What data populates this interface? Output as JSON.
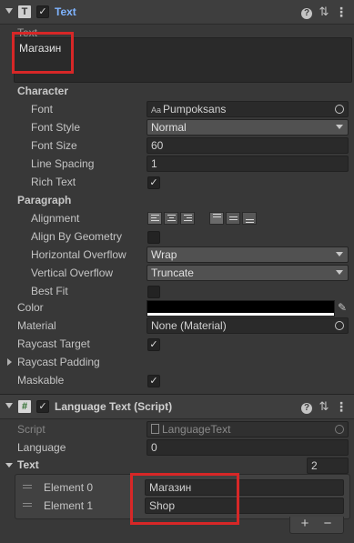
{
  "text_component": {
    "title": "Text",
    "text_label": "Text",
    "text_value": "Магазин",
    "character_section": "Character",
    "font_label": "Font",
    "font_icon": "Aa",
    "font_value": "Pumpoksans",
    "font_style_label": "Font Style",
    "font_style_value": "Normal",
    "font_size_label": "Font Size",
    "font_size_value": "60",
    "line_spacing_label": "Line Spacing",
    "line_spacing_value": "1",
    "rich_text_label": "Rich Text",
    "paragraph_section": "Paragraph",
    "alignment_label": "Alignment",
    "align_by_geometry_label": "Align By Geometry",
    "horizontal_overflow_label": "Horizontal Overflow",
    "horizontal_overflow_value": "Wrap",
    "vertical_overflow_label": "Vertical Overflow",
    "vertical_overflow_value": "Truncate",
    "best_fit_label": "Best Fit",
    "color_label": "Color",
    "color_value": "#000000",
    "material_label": "Material",
    "material_value": "None (Material)",
    "raycast_target_label": "Raycast Target",
    "raycast_padding_label": "Raycast Padding",
    "maskable_label": "Maskable"
  },
  "language_component": {
    "title": "Language Text (Script)",
    "script_label": "Script",
    "script_value": "LanguageText",
    "language_label": "Language",
    "language_value": "0",
    "text_list_label": "Text",
    "text_list_count": "2",
    "elements": [
      {
        "label": "Element 0",
        "value": "Магазин"
      },
      {
        "label": "Element 1",
        "value": "Shop"
      }
    ],
    "add_label": "+",
    "remove_label": "−"
  },
  "colors": {
    "accent_title": "#7fb4ff",
    "highlight_box": "#d72727"
  }
}
